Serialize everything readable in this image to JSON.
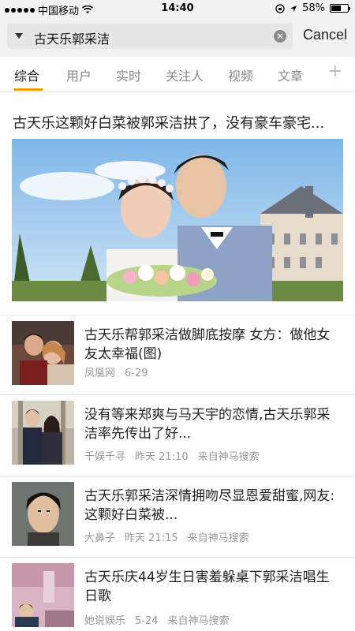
{
  "status_bar": {
    "carrier": "中国移动",
    "time": "14:40",
    "battery": "58%",
    "battery_level": 0.58
  },
  "search": {
    "query": "古天乐郭采洁",
    "cancel_label": "Cancel"
  },
  "tabs": [
    "综合",
    "用户",
    "实时",
    "关注人",
    "视频",
    "文章"
  ],
  "featured": {
    "title": "古天乐这颗好白菜被郭采洁拱了，没有豪车豪宅..."
  },
  "news": [
    {
      "title": "古天乐帮郭采洁做脚底按摩 女方：做他女友太幸福(图)",
      "source": "凤凰网",
      "time": "6-29",
      "via": ""
    },
    {
      "title": "没有等来郑爽与马天宇的恋情,古天乐郭采洁率先传出了好...",
      "source": "千娱千寻",
      "time": "昨天 21:10",
      "via": "来自神马搜索"
    },
    {
      "title": "古天乐郭采洁深情拥吻尽显恩爱甜蜜,网友:这颗好白菜被...",
      "source": "大鼻子",
      "time": "昨天 21:15",
      "via": "来自神马搜索"
    },
    {
      "title": "古天乐庆44岁生日害羞躲桌下郭采洁唱生日歌",
      "source": "她说娱乐",
      "time": "5-24",
      "via": "来自神马搜索"
    }
  ]
}
